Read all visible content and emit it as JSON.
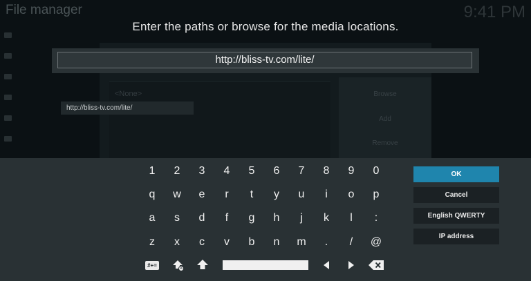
{
  "background": {
    "window_title": "File manager",
    "clock": "9:41 PM",
    "none_label": "<None>",
    "browse_label": "Browse",
    "add_label": "Add",
    "remove_label": "Remove"
  },
  "dialog": {
    "heading": "Enter the paths or browse for the media locations.",
    "input_value": "http://bliss-tv.com/lite/",
    "suggestion": "http://bliss-tv.com/lite/"
  },
  "keyboard": {
    "row1": [
      "1",
      "2",
      "3",
      "4",
      "5",
      "6",
      "7",
      "8",
      "9",
      "0"
    ],
    "row2": [
      "q",
      "w",
      "e",
      "r",
      "t",
      "y",
      "u",
      "i",
      "o",
      "p"
    ],
    "row3": [
      "a",
      "s",
      "d",
      "f",
      "g",
      "h",
      "j",
      "k",
      "l",
      ":"
    ],
    "row4": [
      "z",
      "x",
      "c",
      "v",
      "b",
      "n",
      "m",
      ".",
      "/",
      "@"
    ],
    "symbols_label": "#+=",
    "buttons": {
      "ok": "OK",
      "cancel": "Cancel",
      "layout": "English QWERTY",
      "ip": "IP address"
    }
  },
  "colors": {
    "focus_accent": "#1f85ad",
    "panel": "#293134"
  }
}
